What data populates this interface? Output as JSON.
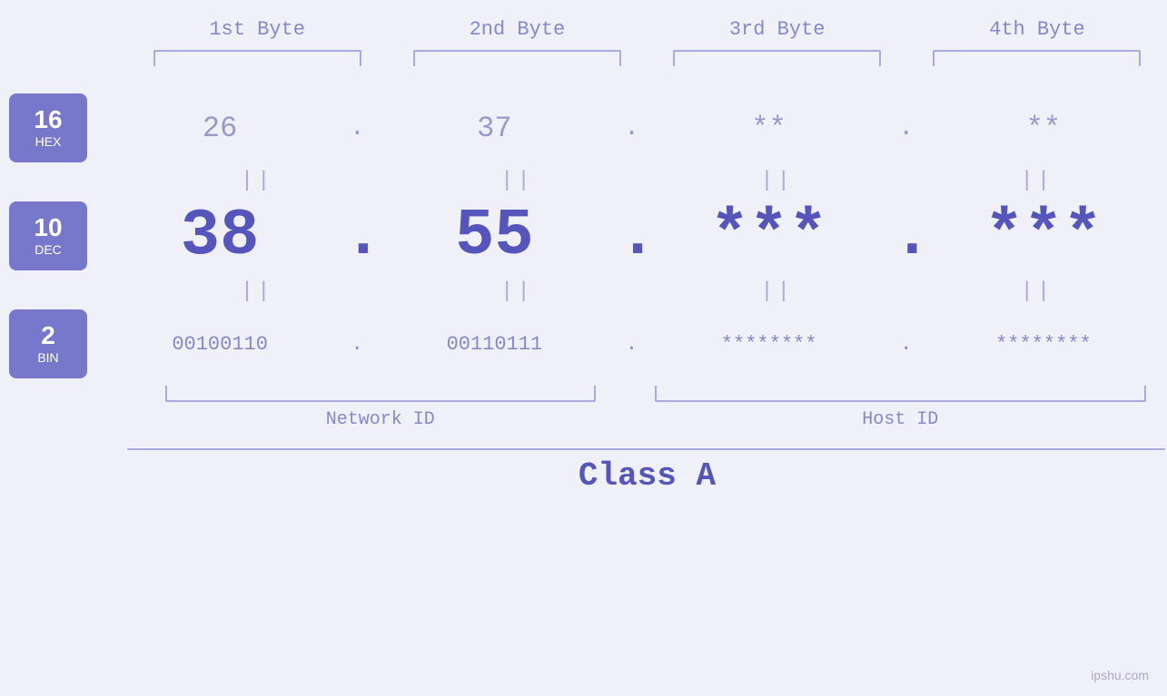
{
  "header": {
    "byte1": "1st Byte",
    "byte2": "2nd Byte",
    "byte3": "3rd Byte",
    "byte4": "4th Byte"
  },
  "badges": {
    "hex": {
      "num": "16",
      "label": "HEX"
    },
    "dec": {
      "num": "10",
      "label": "DEC"
    },
    "bin": {
      "num": "2",
      "label": "BIN"
    }
  },
  "values": {
    "hex": {
      "b1": "26",
      "b2": "37",
      "b3": "**",
      "b4": "**",
      "d1": ".",
      "d2": ".",
      "d3": ".",
      "d4": ""
    },
    "dec": {
      "b1": "38",
      "b2": "55",
      "b3": "***",
      "b4": "***",
      "d1": ".",
      "d2": ".",
      "d3": ".",
      "d4": ""
    },
    "bin": {
      "b1": "00100110",
      "b2": "00110111",
      "b3": "********",
      "b4": "********",
      "d1": ".",
      "d2": ".",
      "d3": ".",
      "d4": ""
    }
  },
  "labels": {
    "network_id": "Network ID",
    "host_id": "Host ID",
    "class": "Class A",
    "watermark": "ipshu.com"
  },
  "separators": {
    "bars": "||"
  }
}
